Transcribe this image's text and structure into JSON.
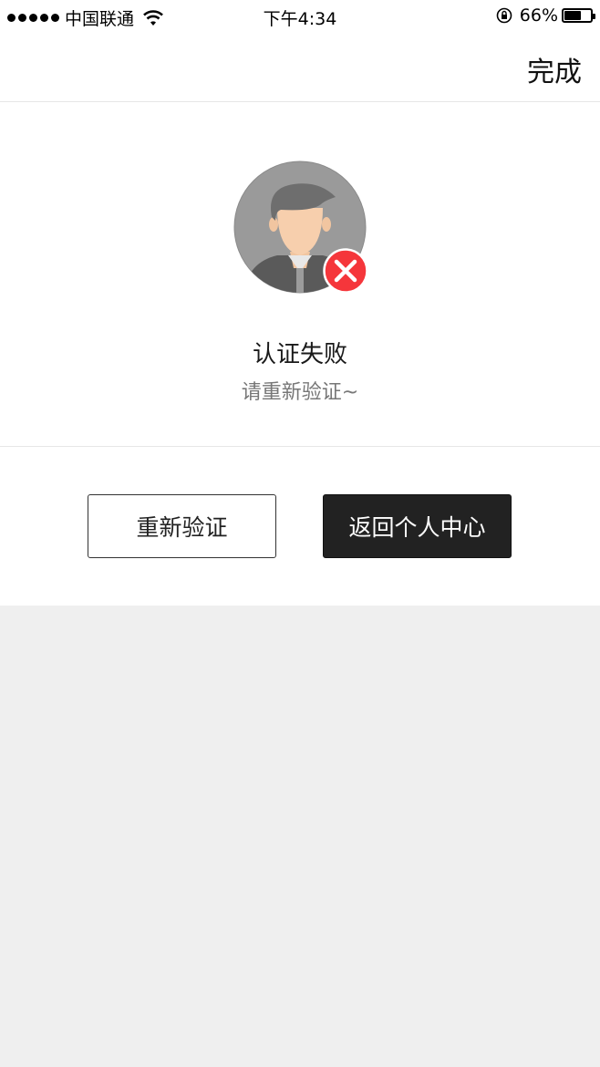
{
  "status_bar": {
    "carrier": "中国联通",
    "time": "下午4:34",
    "battery_percent": "66%",
    "battery_level": 0.66
  },
  "navbar": {
    "done_label": "完成"
  },
  "result": {
    "title": "认证失败",
    "subtitle": "请重新验证~",
    "badge_color": "#f5363b"
  },
  "actions": {
    "retry_label": "重新验证",
    "back_label": "返回个人中心"
  }
}
